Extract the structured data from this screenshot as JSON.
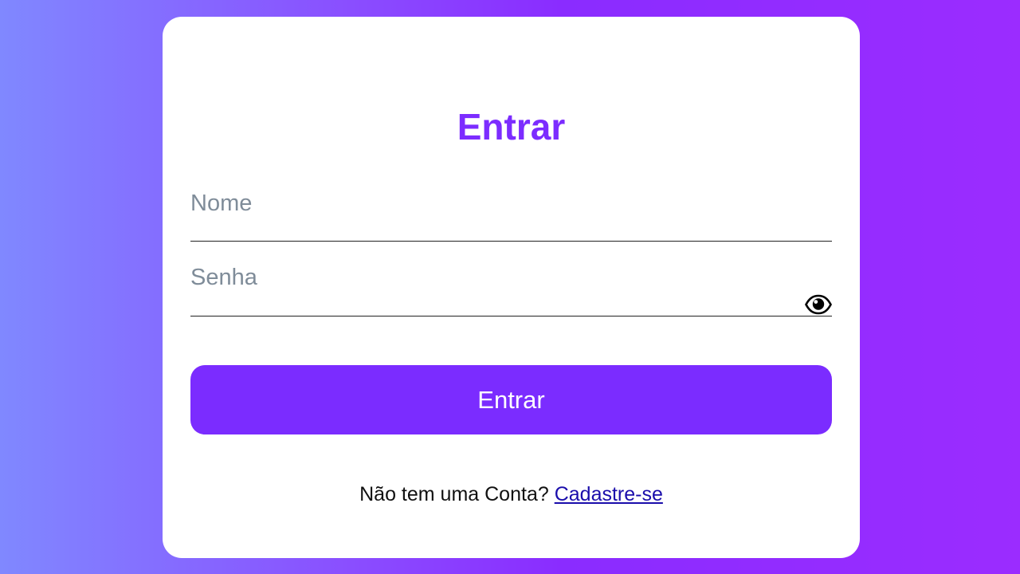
{
  "colors": {
    "accent": "#7b2cff",
    "title": "#7c2cff",
    "link": "#1a0dab",
    "card_background": "#ffffff",
    "page_gradient": [
      "#8088ff",
      "#8a2cff",
      "#9b2cff"
    ]
  },
  "login": {
    "title": "Entrar",
    "name_placeholder": "Nome",
    "name_value": "",
    "password_placeholder": "Senha",
    "password_value": "",
    "toggle_icon": "eye-icon",
    "submit_label": "Entrar",
    "signup_prompt": "Não tem uma Conta?",
    "signup_link": "Cadastre-se"
  }
}
